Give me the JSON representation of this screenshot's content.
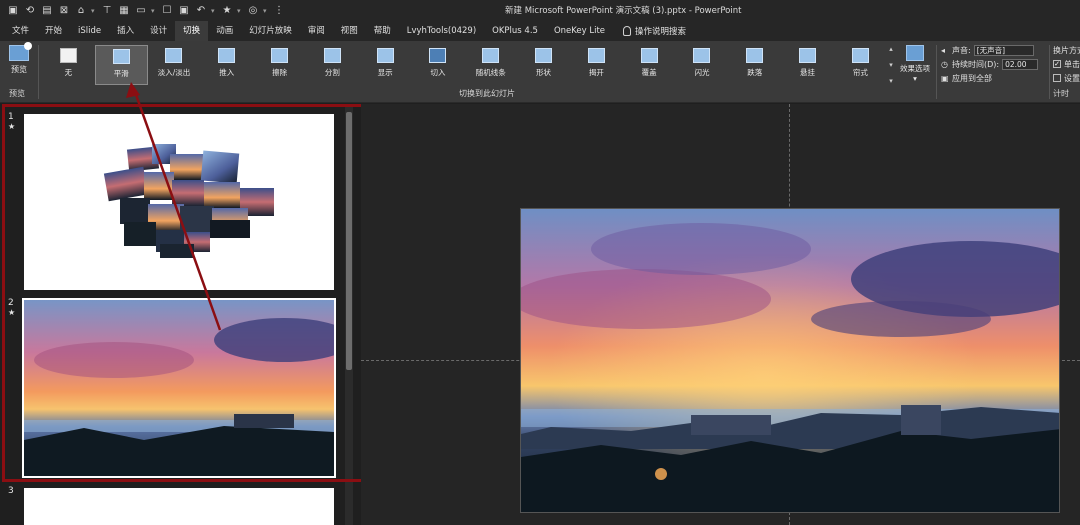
{
  "window": {
    "title": "新建 Microsoft PowerPoint 演示文稿 (3).pptx  -  PowerPoint"
  },
  "quick_access": [
    "save-icon",
    "autosave-icon",
    "icon-2",
    "icon-3",
    "icon-4",
    "format-painter-icon",
    "icon-6",
    "icon-7",
    "icon-8",
    "undo-icon",
    "star-icon",
    "icon-11",
    "more-icon"
  ],
  "tabs": [
    {
      "label": "文件"
    },
    {
      "label": "开始"
    },
    {
      "label": "iSlide"
    },
    {
      "label": "插入"
    },
    {
      "label": "设计"
    },
    {
      "label": "切换"
    },
    {
      "label": "动画"
    },
    {
      "label": "幻灯片放映"
    },
    {
      "label": "审阅"
    },
    {
      "label": "视图"
    },
    {
      "label": "帮助"
    },
    {
      "label": "LvyhTools(0429)"
    },
    {
      "label": "OKPlus 4.5"
    },
    {
      "label": "OneKey Lite"
    }
  ],
  "active_tab": "切换",
  "tell_me": "操作说明搜索",
  "ribbon": {
    "preview_label": "预览",
    "preview_group": "预览",
    "transitions_group": "切换到此幻灯片",
    "timing_group": "计时",
    "effects_label": "效果选项",
    "gallery": [
      {
        "label": "无"
      },
      {
        "label": "平滑"
      },
      {
        "label": "淡入/淡出"
      },
      {
        "label": "推入"
      },
      {
        "label": "擦除"
      },
      {
        "label": "分割"
      },
      {
        "label": "显示"
      },
      {
        "label": "切入"
      },
      {
        "label": "随机线条"
      },
      {
        "label": "形状"
      },
      {
        "label": "揭开"
      },
      {
        "label": "覆盖"
      },
      {
        "label": "闪光"
      },
      {
        "label": "跌落"
      },
      {
        "label": "悬挂"
      },
      {
        "label": "帘式"
      }
    ],
    "selected_transition": "平滑",
    "timing": {
      "sound_label": "声音:",
      "sound_value": "[无声音]",
      "duration_label": "持续时间(D):",
      "duration_value": "02.00",
      "apply_all_label": "应用到全部"
    },
    "advance": {
      "title": "换片方式",
      "on_click_label": "单击",
      "after_label": "设置"
    }
  },
  "slides": [
    {
      "number": "1",
      "star": "★"
    },
    {
      "number": "2",
      "star": "★"
    },
    {
      "number": "3"
    }
  ],
  "colors": {
    "highlight_box": "#8b0e12",
    "arrow": "#8b0e12"
  }
}
